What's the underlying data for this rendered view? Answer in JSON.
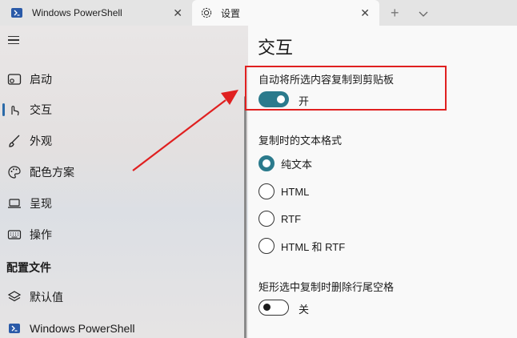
{
  "tabs": [
    {
      "label": "Windows PowerShell",
      "active": false
    },
    {
      "label": "设置",
      "active": true
    }
  ],
  "tab_actions": {
    "new_tab": "+",
    "dropdown": "⌄"
  },
  "sidebar": {
    "items": [
      {
        "label": "启动",
        "icon": "startup-icon"
      },
      {
        "label": "交互",
        "icon": "interaction-icon",
        "active": true
      },
      {
        "label": "外观",
        "icon": "appearance-brush-icon"
      },
      {
        "label": "配色方案",
        "icon": "palette-icon"
      },
      {
        "label": "呈现",
        "icon": "laptop-icon"
      },
      {
        "label": "操作",
        "icon": "keyboard-icon"
      }
    ],
    "profiles_header": "配置文件",
    "profiles": [
      {
        "label": "默认值",
        "icon": "layers-icon"
      },
      {
        "label": "Windows PowerShell",
        "icon": "powershell-icon"
      }
    ]
  },
  "content": {
    "title": "交互",
    "copy_on_select": {
      "label": "自动将所选内容复制到剪贴板",
      "state": "开",
      "on": true
    },
    "copy_format": {
      "label": "复制时的文本格式",
      "options": [
        "纯文本",
        "HTML",
        "RTF",
        "HTML 和 RTF"
      ],
      "selected": "纯文本"
    },
    "trim_block": {
      "label": "矩形选中复制时删除行尾空格",
      "state": "关",
      "on": false
    }
  },
  "colors": {
    "accent": "#2b7a8c",
    "annotation": "#e02020",
    "nav_indicator": "#2b6aa8"
  }
}
